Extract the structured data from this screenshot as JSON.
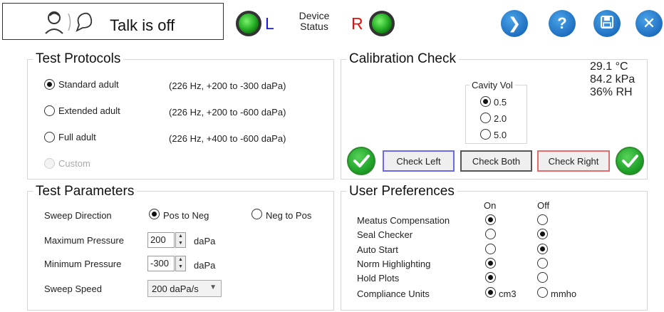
{
  "header": {
    "talk_label": "Talk is off",
    "left_label": "L",
    "right_label": "R",
    "device_status": "Device Status",
    "colors": {
      "left": "#1a1ae6",
      "right": "#e01010",
      "led_on": "#2bb52b"
    }
  },
  "toolbar": {
    "next_glyph": "❯",
    "help_glyph": "?",
    "close_glyph": "✕"
  },
  "test_protocols": {
    "title": "Test Protocols",
    "items": [
      {
        "label": "Standard adult",
        "detail": "(226 Hz, +200 to -300 daPa)",
        "selected": true,
        "enabled": true
      },
      {
        "label": "Extended adult",
        "detail": "(226 Hz, +200 to -600 daPa)",
        "selected": false,
        "enabled": true
      },
      {
        "label": "Full adult",
        "detail": "(226 Hz, +400 to -600 daPa)",
        "selected": false,
        "enabled": true
      },
      {
        "label": "Custom",
        "detail": "",
        "selected": false,
        "enabled": false
      }
    ]
  },
  "test_parameters": {
    "title": "Test Parameters",
    "sweep_direction_label": "Sweep Direction",
    "sweep_options": [
      "Pos to Neg",
      "Neg to Pos"
    ],
    "sweep_selected": "Pos to Neg",
    "max_pressure_label": "Maximum Pressure",
    "max_pressure_value": "200",
    "min_pressure_label": "Minimum Pressure",
    "min_pressure_value": "-300",
    "pressure_unit": "daPa",
    "sweep_speed_label": "Sweep Speed",
    "sweep_speed_value": "200 daPa/s"
  },
  "calibration": {
    "title": "Calibration Check",
    "temperature": "29.1 °C",
    "pressure": "84.2 kPa",
    "humidity": "36% RH",
    "cavity_title": "Cavity Vol",
    "cavity_options": [
      "0.5",
      "2.0",
      "5.0"
    ],
    "cavity_selected": "0.5",
    "check_left": "Check Left",
    "check_both": "Check Both",
    "check_right": "Check Right",
    "left_status": "pass",
    "right_status": "pass"
  },
  "user_preferences": {
    "title": "User Preferences",
    "on_label": "On",
    "off_label": "Off",
    "rows": [
      {
        "label": "Meatus Compensation",
        "value": "on"
      },
      {
        "label": "Seal Checker",
        "value": "off"
      },
      {
        "label": "Auto Start",
        "value": "off"
      },
      {
        "label": "Norm Highlighting",
        "value": "on"
      },
      {
        "label": "Hold Plots",
        "value": "on"
      }
    ],
    "compliance_label": "Compliance Units",
    "compliance_options": [
      "cm3",
      "mmho"
    ],
    "compliance_selected": "cm3"
  }
}
